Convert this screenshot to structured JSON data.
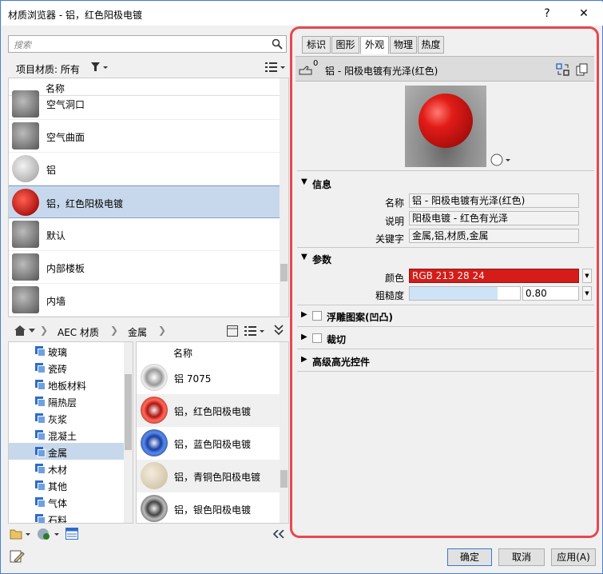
{
  "window": {
    "title": "材质浏览器 - 铝，红色阳极电镀",
    "help": "?",
    "close": "✕"
  },
  "search": {
    "placeholder": "搜索"
  },
  "filter": {
    "label": "项目材质: 所有"
  },
  "project_list": {
    "header": "名称",
    "items": [
      {
        "name": "空气洞口",
        "swatch": "#7a7a7a"
      },
      {
        "name": "空气曲面",
        "swatch": "#7a7a7a"
      },
      {
        "name": "铝",
        "swatch": "#c8c8c8"
      },
      {
        "name": "铝，红色阳极电镀",
        "swatch": "#d21c18",
        "selected": true
      },
      {
        "name": "默认",
        "swatch": "#7a7a7a"
      },
      {
        "name": "内部楼板",
        "swatch": "#7a7a7a"
      },
      {
        "name": "内墙",
        "swatch": "#7a7a7a"
      }
    ]
  },
  "breadcrumb": {
    "root": "AEC 材质",
    "current": "金属"
  },
  "library_tree": {
    "items": [
      {
        "name": "玻璃"
      },
      {
        "name": "瓷砖"
      },
      {
        "name": "地板材料"
      },
      {
        "name": "隔热层"
      },
      {
        "name": "灰浆"
      },
      {
        "name": "混凝土"
      },
      {
        "name": "金属",
        "selected": true
      },
      {
        "name": "木材"
      },
      {
        "name": "其他"
      },
      {
        "name": "气体"
      },
      {
        "name": "石料"
      }
    ]
  },
  "library_list": {
    "header": "名称",
    "items": [
      {
        "name": "铝 7075",
        "swatch": "#bdbdbd"
      },
      {
        "name": "铝，红色阳极电镀",
        "swatch": "#b01512"
      },
      {
        "name": "铝，蓝色阳极电镀",
        "swatch": "#1640a8"
      },
      {
        "name": "铝，青铜色阳极电镀",
        "swatch": "#d8cbb2"
      },
      {
        "name": "铝，银色阳极电镀",
        "swatch": "#7d7d7d"
      }
    ]
  },
  "tabs": [
    {
      "label": "标识"
    },
    {
      "label": "图形"
    },
    {
      "label": "外观",
      "active": true
    },
    {
      "label": "物理"
    },
    {
      "label": "热度"
    }
  ],
  "appearance": {
    "asset_count": "0",
    "asset_name": "铝 - 阳极电镀有光泽(红色)",
    "info_title": "信息",
    "name_label": "名称",
    "name_value": "铝 - 阳极电镀有光泽(红色)",
    "desc_label": "说明",
    "desc_value": "阳极电镀 - 红色有光泽",
    "keywords_label": "关键字",
    "keywords_value": "金属,铝,材质,金属",
    "params_title": "参数",
    "color_label": "颜色",
    "color_value": "RGB 213 28 24",
    "color_hex": "#d51c18",
    "roughness_label": "粗糙度",
    "roughness_value": "0.80",
    "roughness_fraction": 0.8,
    "relief_title": "浮雕图案(凹凸)",
    "cutout_title": "裁切",
    "highlight_title": "高级高光控件"
  },
  "footer": {
    "ok": "确定",
    "cancel": "取消",
    "apply": "应用(A)"
  }
}
